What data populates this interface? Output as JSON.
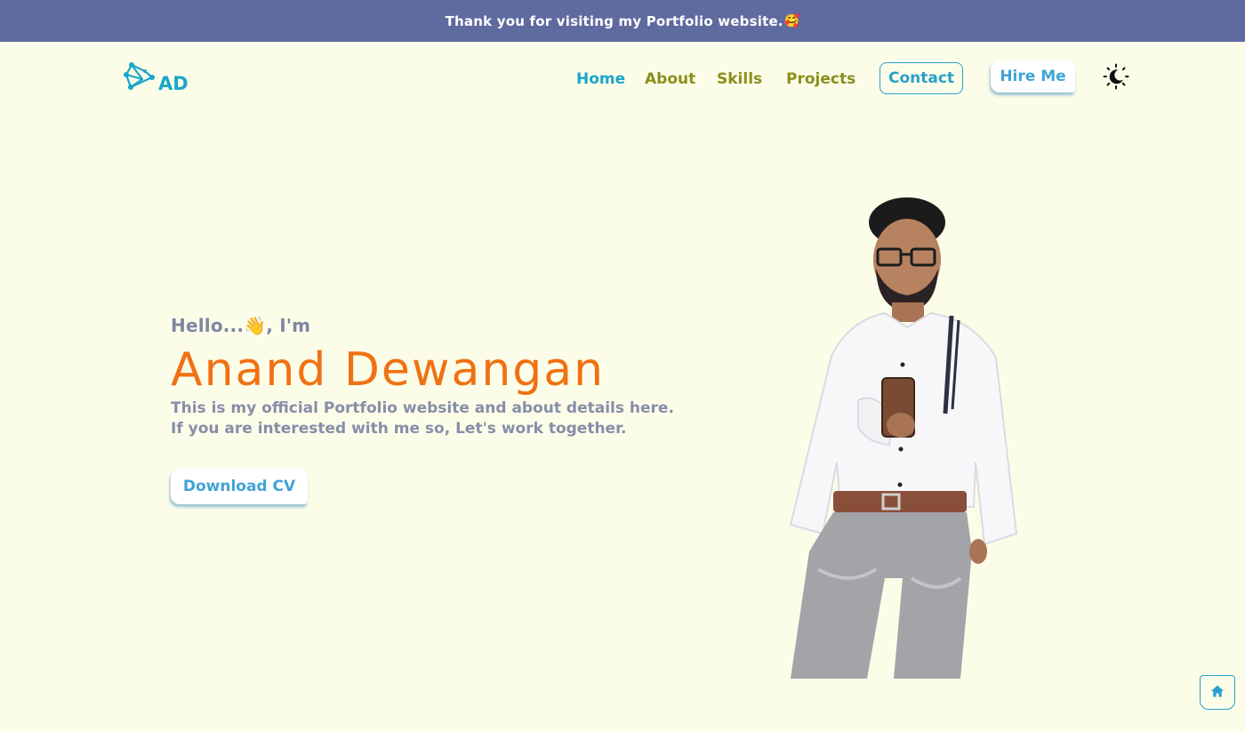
{
  "announcement": {
    "text": "Thank you for visiting my Portfolio website.",
    "emoji": "🥰"
  },
  "brand": {
    "logo_icon": "network-logo-icon",
    "text": "AD",
    "color": "#1aa6c9"
  },
  "nav": {
    "items": [
      {
        "label": "Home",
        "active": true
      },
      {
        "label": "About",
        "active": false
      },
      {
        "label": "Skills",
        "active": false
      },
      {
        "label": "Projects",
        "active": false
      }
    ],
    "contact_label": "Contact",
    "hire_label": "Hire Me",
    "theme_toggle_icon": "moon-icon"
  },
  "hero": {
    "greeting": "Hello...👋, I'm",
    "name": "Anand Dewangan",
    "description": "This is my official Portfolio website and about details here. If you are interested with me so, Let's work together.",
    "cta_label": "Download CV",
    "portrait_icon": "portrait-photo"
  },
  "fab": {
    "icon": "home-icon"
  },
  "colors": {
    "banner": "#5f6a9f",
    "background": "#fcfde9",
    "accent_teal": "#1aa6c9",
    "accent_olive": "#8a8f1c",
    "name_orange": "#f07112",
    "muted_text": "#878ea9"
  }
}
